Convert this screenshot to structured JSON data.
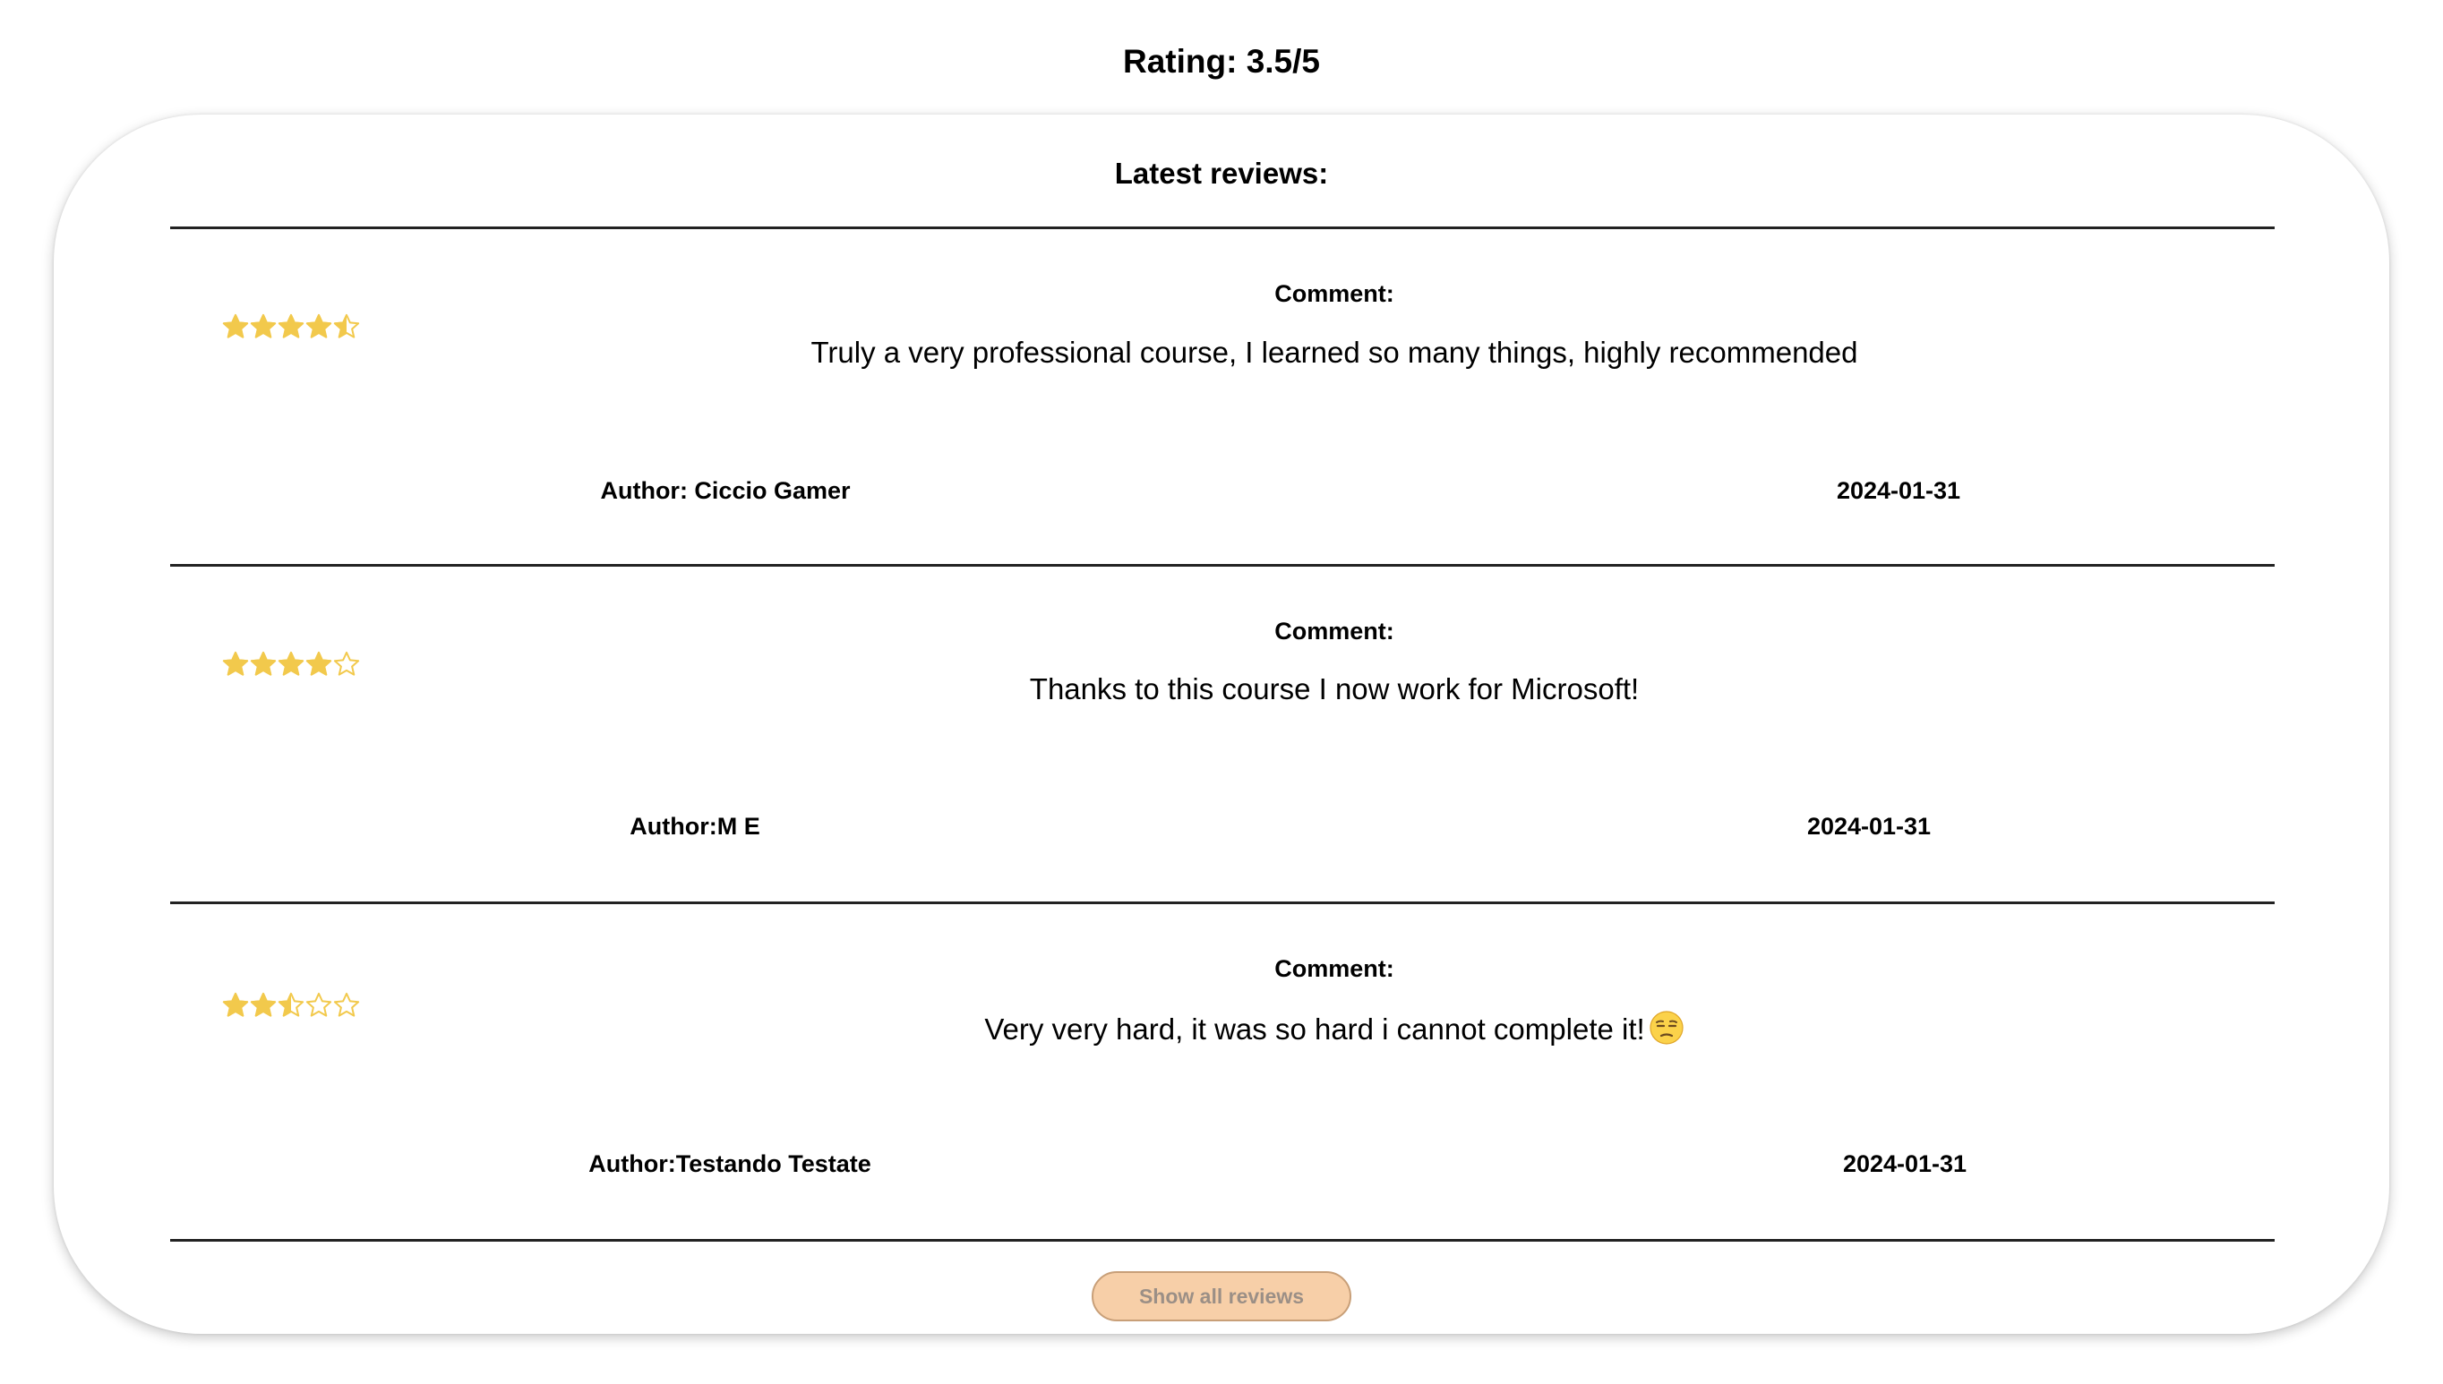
{
  "rating": {
    "label": "Rating: 3.5/5",
    "value": 3.5,
    "max": 5
  },
  "reviews_section": {
    "title": "Latest reviews:"
  },
  "reviews": [
    {
      "stars": 4.5,
      "comment_label": "Comment:",
      "comment": "Truly a very professional course, I learned so many things, highly recommended",
      "author": "Author: Ciccio Gamer",
      "date": "2024-01-31"
    },
    {
      "stars": 4,
      "comment_label": "Comment:",
      "comment": "Thanks to this course I now work for Microsoft!",
      "author": "Author:M E",
      "date": "2024-01-31"
    },
    {
      "stars": 2.5,
      "comment_label": "Comment:",
      "comment": "Very very hard, it was so hard i cannot complete it!",
      "comment_emoji": "unamused-face-icon",
      "author": "Author:Testando Testate",
      "date": "2024-01-31"
    }
  ],
  "buttons": {
    "show_all": "Show all reviews"
  },
  "colors": {
    "star": "#f2c94c",
    "button_bg": "#f7cfa8",
    "button_border": "#c89f78",
    "button_text": "#9b8f86",
    "divider": "#222222"
  }
}
